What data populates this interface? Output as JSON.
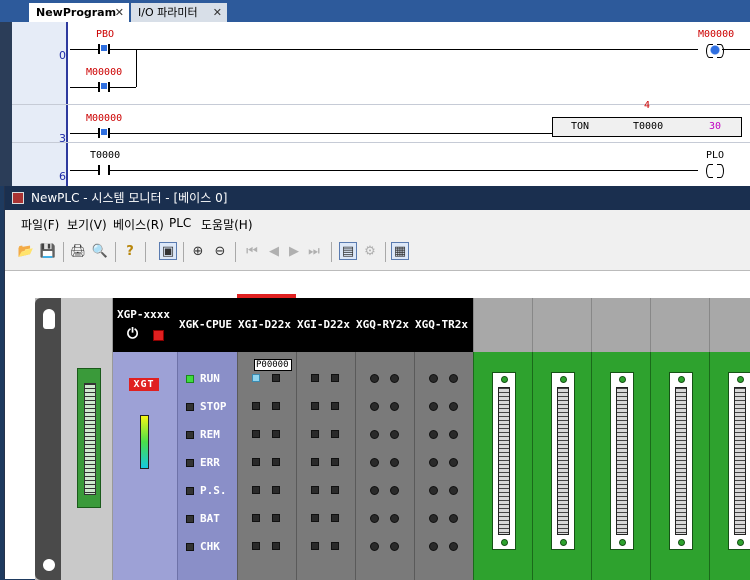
{
  "tabs": [
    {
      "label": "NewProgram",
      "close": "✕"
    },
    {
      "label": "I/O 파라미터",
      "close": "✕"
    }
  ],
  "ladder": {
    "rung_numbers": [
      "0",
      "3",
      "6"
    ],
    "contacts": {
      "pbo": "PBO",
      "m00000_a": "M00000",
      "m00000_b": "M00000",
      "t0000": "T0000"
    },
    "coils": {
      "m00000": "M00000",
      "plo": "PLO"
    },
    "ton": {
      "name": "TON",
      "timer": "T0000",
      "preset": "30",
      "current": "4"
    }
  },
  "monitor": {
    "title": "NewPLC - 시스템 모니터 - [베이스 0]",
    "menus": [
      "파일(F)",
      "보기(V)",
      "베이스(R)",
      "PLC",
      "도움말(H)"
    ],
    "modules": {
      "cpu_name": "XGP-xxxx",
      "cpu_logo": "XGT",
      "gpu_name": "XGK-CPUE",
      "io1_name": "XGI-D22x",
      "io2_name": "XGI-D22x",
      "io3_name": "XGQ-RY2x",
      "io4_name": "XGQ-TR2x",
      "io1_address": "P00000"
    },
    "leds": [
      "RUN",
      "STOP",
      "REM",
      "ERR",
      "P.S.",
      "BAT",
      "CHK"
    ],
    "colors": {
      "run_led": "#3fdc3f",
      "active_input": "#8fd4ef",
      "slot_green": "#2ea22e"
    }
  }
}
